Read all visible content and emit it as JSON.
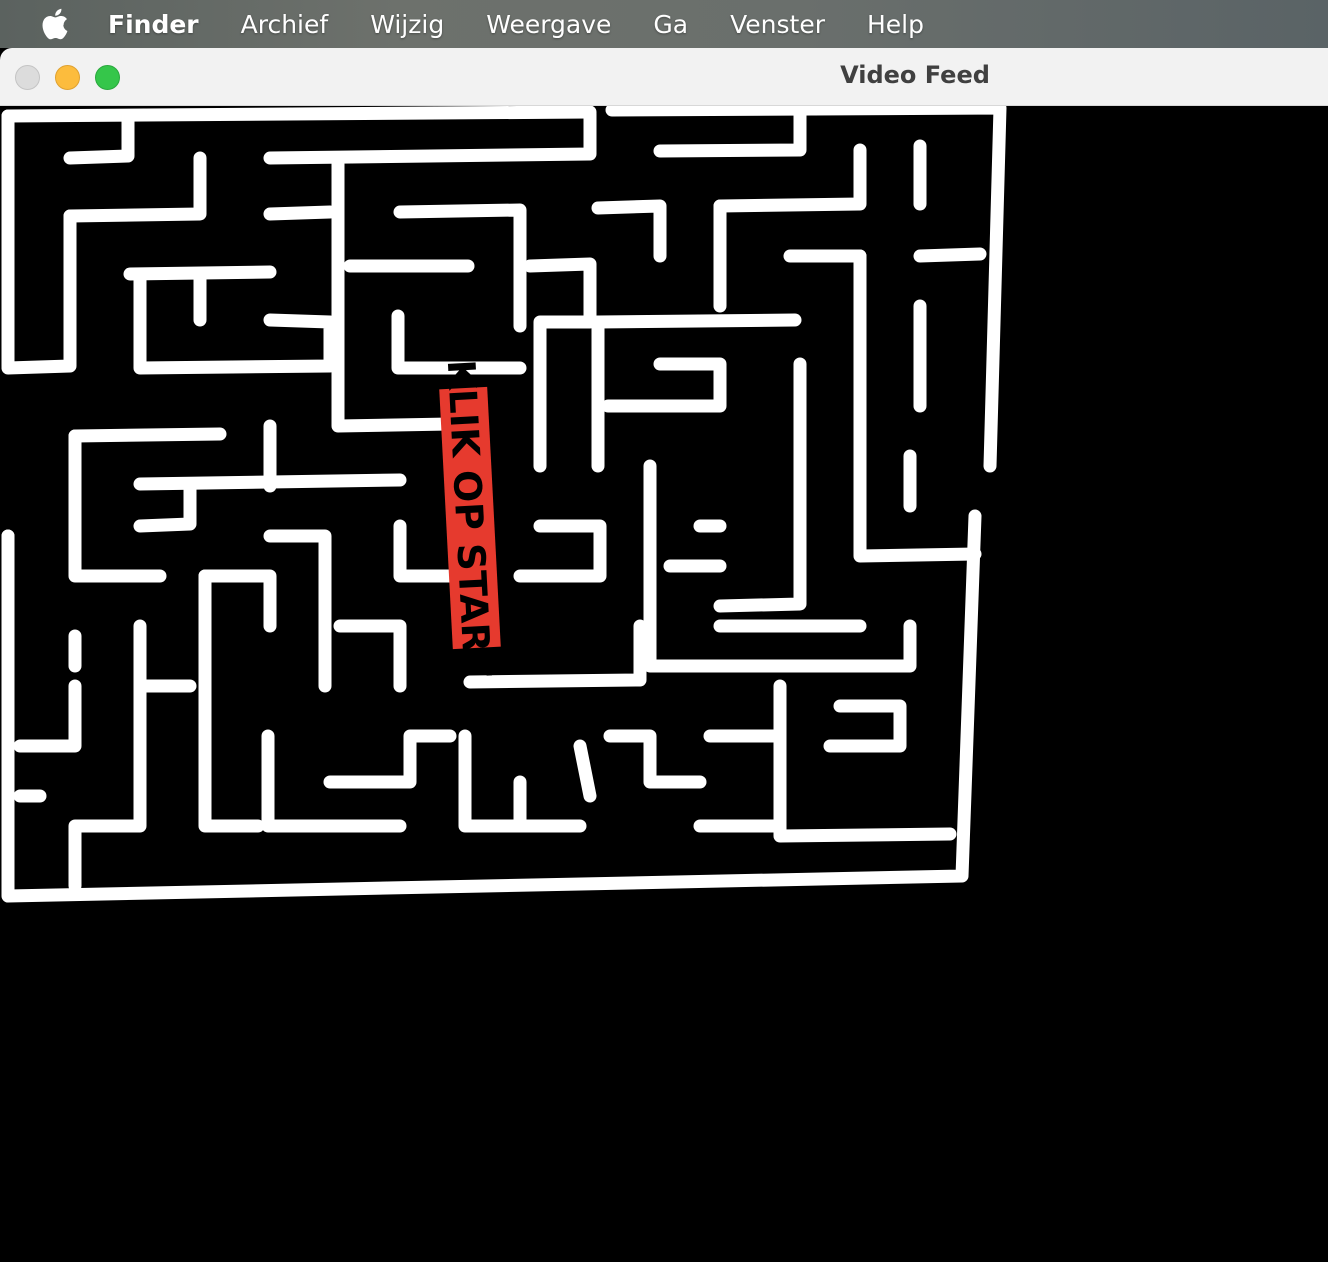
{
  "menubar": {
    "apple_icon": "apple-logo-icon",
    "items": [
      {
        "label": "Finder",
        "bold": true
      },
      {
        "label": "Archief"
      },
      {
        "label": "Wijzig"
      },
      {
        "label": "Weergave"
      },
      {
        "label": "Ga"
      },
      {
        "label": "Venster"
      },
      {
        "label": "Help"
      }
    ]
  },
  "window": {
    "title": "Video Feed",
    "buttons": {
      "close": {
        "icon": "close-icon",
        "color": "#dcdcdc"
      },
      "minimize": {
        "icon": "minimize-icon",
        "color": "#fcbc3d"
      },
      "zoom": {
        "icon": "zoom-icon",
        "color": "#35c64a"
      }
    }
  },
  "video_feed": {
    "maze_label": "KLIK OP START",
    "label_color": "#e63a2e",
    "wall_color": "#ffffff",
    "background_color": "#000000"
  }
}
